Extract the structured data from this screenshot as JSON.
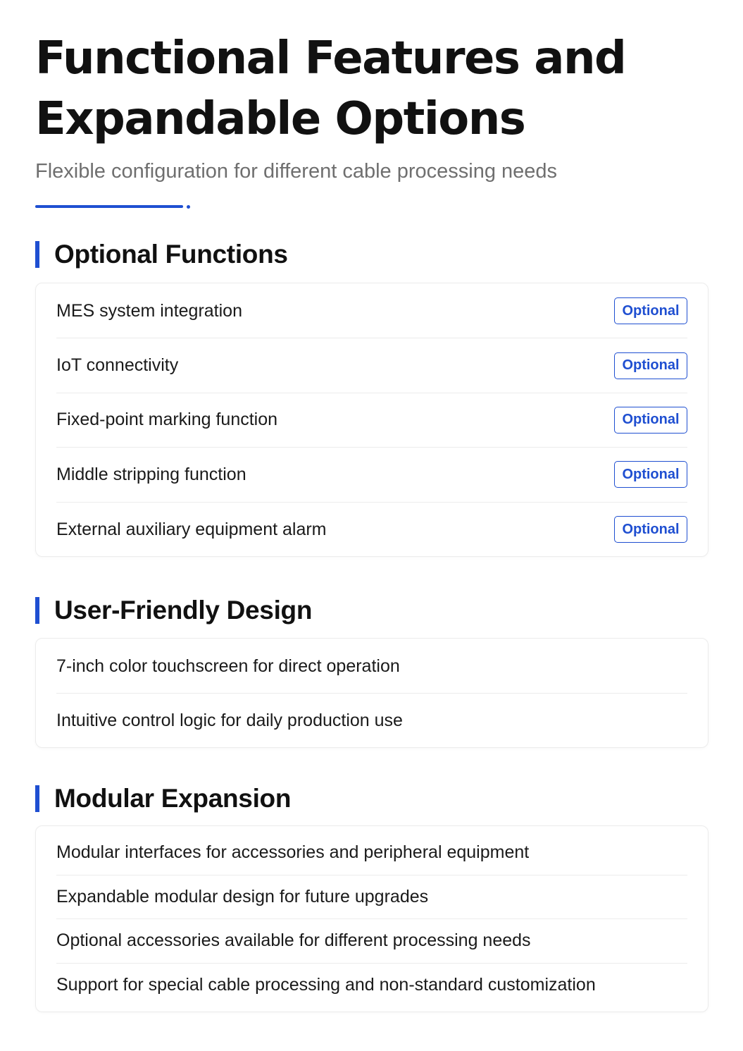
{
  "header": {
    "title_line1": "Functional Features and",
    "title_line2": "Expandable Options",
    "subtitle": "Flexible configuration for different cable processing needs"
  },
  "colors": {
    "accent": "#1f4fd1",
    "text": "#111111",
    "subtitle": "#6f6f6f",
    "divider": "#ececec"
  },
  "sections": [
    {
      "title": "Optional Functions",
      "items": [
        {
          "label": "MES system integration",
          "badge": "Optional"
        },
        {
          "label": "IoT connectivity",
          "badge": "Optional"
        },
        {
          "label": "Fixed-point marking function",
          "badge": "Optional"
        },
        {
          "label": "Middle stripping function",
          "badge": "Optional"
        },
        {
          "label": "External auxiliary equipment alarm",
          "badge": "Optional"
        }
      ]
    },
    {
      "title": "User-Friendly Design",
      "items": [
        {
          "label": "7-inch color touchscreen for direct operation"
        },
        {
          "label": "Intuitive control logic for daily production use"
        }
      ]
    },
    {
      "title": "Modular Expansion",
      "items": [
        {
          "label": "Modular interfaces for accessories and peripheral equipment"
        },
        {
          "label": "Expandable modular design for future upgrades"
        },
        {
          "label": "Optional accessories available for different processing needs"
        },
        {
          "label": "Support for special cable processing and non-standard customization"
        }
      ]
    }
  ]
}
